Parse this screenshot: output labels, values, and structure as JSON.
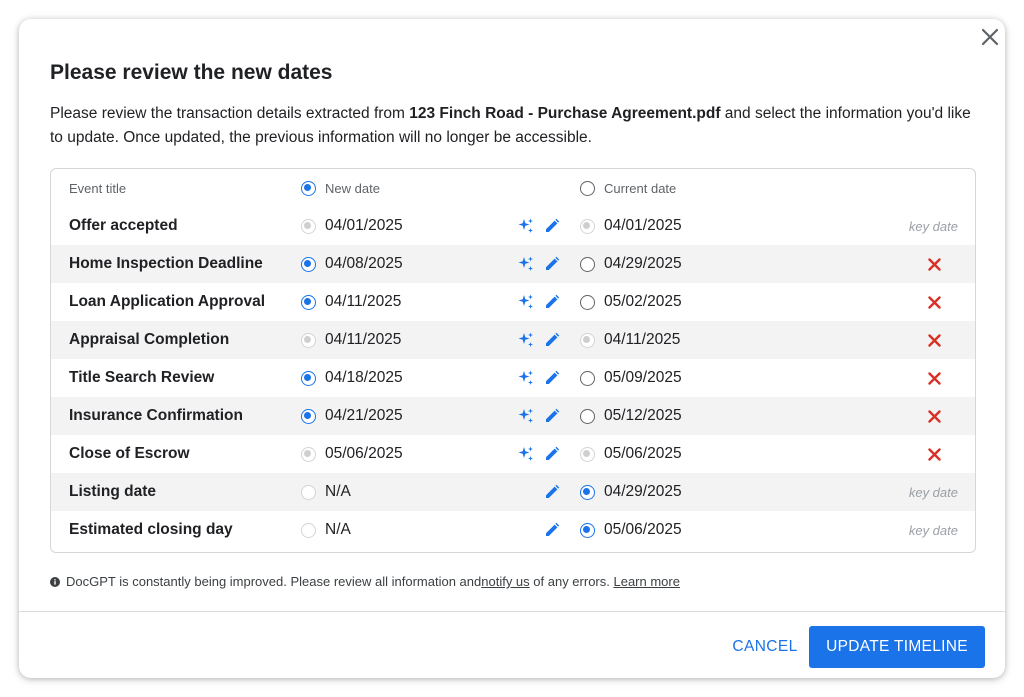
{
  "dialog": {
    "title": "Please review the new dates",
    "description_pre": "Please review the transaction details extracted from ",
    "description_file": "123 Finch Road - Purchase Agreement.pdf",
    "description_post": " and select the information you'd like to update. Once updated, the previous information will no longer be accessible."
  },
  "table": {
    "headers": {
      "event_title": "Event title",
      "new_date": "New date",
      "current_date": "Current date"
    },
    "rows": [
      {
        "title": "Offer accepted",
        "new_date": "04/01/2025",
        "new_state": "disabled-filled",
        "ai": true,
        "current_date": "04/01/2025",
        "current_state": "disabled-filled",
        "end": "key date"
      },
      {
        "title": "Home Inspection Deadline",
        "new_date": "04/08/2025",
        "new_state": "checked",
        "ai": true,
        "current_date": "04/29/2025",
        "current_state": "unchecked",
        "end": "remove"
      },
      {
        "title": "Loan Application Approval",
        "new_date": "04/11/2025",
        "new_state": "checked",
        "ai": true,
        "current_date": "05/02/2025",
        "current_state": "unchecked",
        "end": "remove"
      },
      {
        "title": "Appraisal Completion",
        "new_date": "04/11/2025",
        "new_state": "disabled-filled",
        "ai": true,
        "current_date": "04/11/2025",
        "current_state": "disabled-filled",
        "end": "remove"
      },
      {
        "title": "Title Search Review",
        "new_date": "04/18/2025",
        "new_state": "checked",
        "ai": true,
        "current_date": "05/09/2025",
        "current_state": "unchecked",
        "end": "remove"
      },
      {
        "title": "Insurance Confirmation",
        "new_date": "04/21/2025",
        "new_state": "checked",
        "ai": true,
        "current_date": "05/12/2025",
        "current_state": "unchecked",
        "end": "remove"
      },
      {
        "title": "Close of Escrow",
        "new_date": "05/06/2025",
        "new_state": "disabled-filled",
        "ai": true,
        "current_date": "05/06/2025",
        "current_state": "disabled-filled",
        "end": "remove"
      },
      {
        "title": "Listing date",
        "new_date": "N/A",
        "new_state": "disabled",
        "ai": false,
        "current_date": "04/29/2025",
        "current_state": "checked",
        "end": "key date"
      },
      {
        "title": "Estimated closing day",
        "new_date": "N/A",
        "new_state": "disabled",
        "ai": false,
        "current_date": "05/06/2025",
        "current_state": "checked",
        "end": "key date"
      }
    ]
  },
  "notice": {
    "text_pre": "DocGPT is constantly being improved. Please review all information and ",
    "link_notify": "notify us",
    "text_mid": " of any errors. ",
    "link_learn": "Learn more"
  },
  "footer": {
    "cancel_label": "CANCEL",
    "update_label": "UPDATE TIMELINE"
  },
  "colors": {
    "accent": "#1a73e8",
    "remove": "#d93025",
    "row_alt": "#f3f3f3"
  },
  "icons": [
    "close-icon",
    "sparkle-icon",
    "pencil-icon",
    "remove-x-icon",
    "info-icon"
  ]
}
